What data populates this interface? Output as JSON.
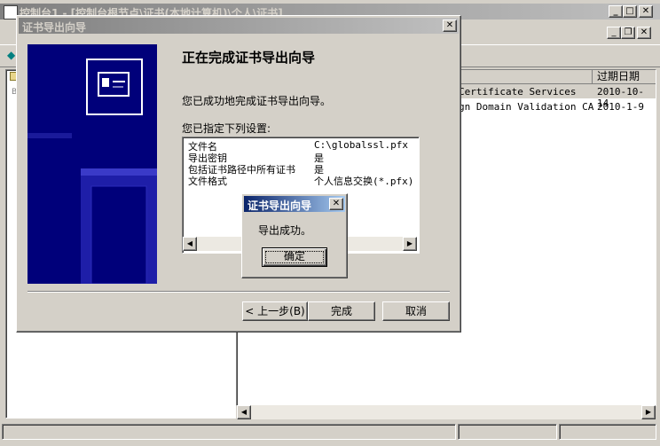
{
  "mmc": {
    "window_title": "控制台1 - [控制台根节点\\证书(本地计算机)\\个人\\证书]",
    "col_expires": "过期日期",
    "rows": [
      {
        "issuer": "Certificate Services",
        "expires": "2010-10-14"
      },
      {
        "issuer": "gn Domain Validation CA",
        "expires": "2010-1-9"
      }
    ]
  },
  "wizard": {
    "title": "证书导出向导",
    "heading": "正在完成证书导出向导",
    "success_text": "您已成功地完成证书导出向导。",
    "settings_label": "您已指定下列设置:",
    "settings": [
      {
        "key": "文件名",
        "value": "C:\\globalssl.pfx"
      },
      {
        "key": "导出密钥",
        "value": "是"
      },
      {
        "key": "包括证书路径中所有证书",
        "value": "是"
      },
      {
        "key": "文件格式",
        "value": "个人信息交换(*.pfx)"
      }
    ],
    "back_label": "< 上一步(B)",
    "finish_label": "完成",
    "cancel_label": "取消"
  },
  "msgbox": {
    "title": "证书导出向导",
    "message": "导出成功。",
    "ok_label": "确定"
  },
  "colors": {
    "active_title": "#0a246a",
    "inactive_title": "#808080",
    "wizard_banner": "#00007a"
  }
}
